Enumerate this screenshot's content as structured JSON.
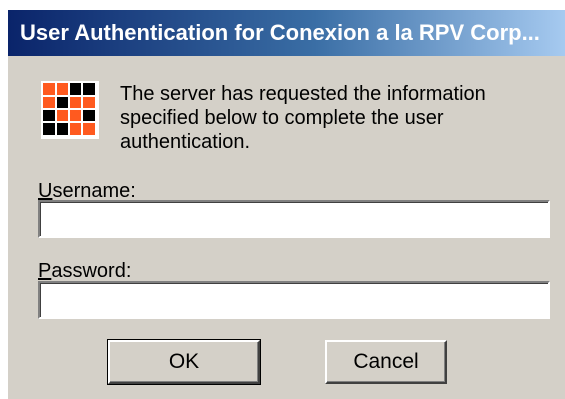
{
  "window": {
    "title": "User Authentication for Conexion a la RPV Corp..."
  },
  "dialog": {
    "icon": "authentication-icon",
    "message": "The server has requested the information specified below to complete the user authentication.",
    "username": {
      "label_accel": "U",
      "label_rest": "sername:",
      "value": ""
    },
    "password": {
      "label_accel": "P",
      "label_rest": "assword:",
      "value": ""
    },
    "ok_label": "OK",
    "cancel_label": "Cancel"
  },
  "colors": {
    "title_start": "#0a246a",
    "title_end": "#a6caf0",
    "dialog_bg": "#d4d0c8",
    "icon_orange": "#ff5a1f"
  }
}
